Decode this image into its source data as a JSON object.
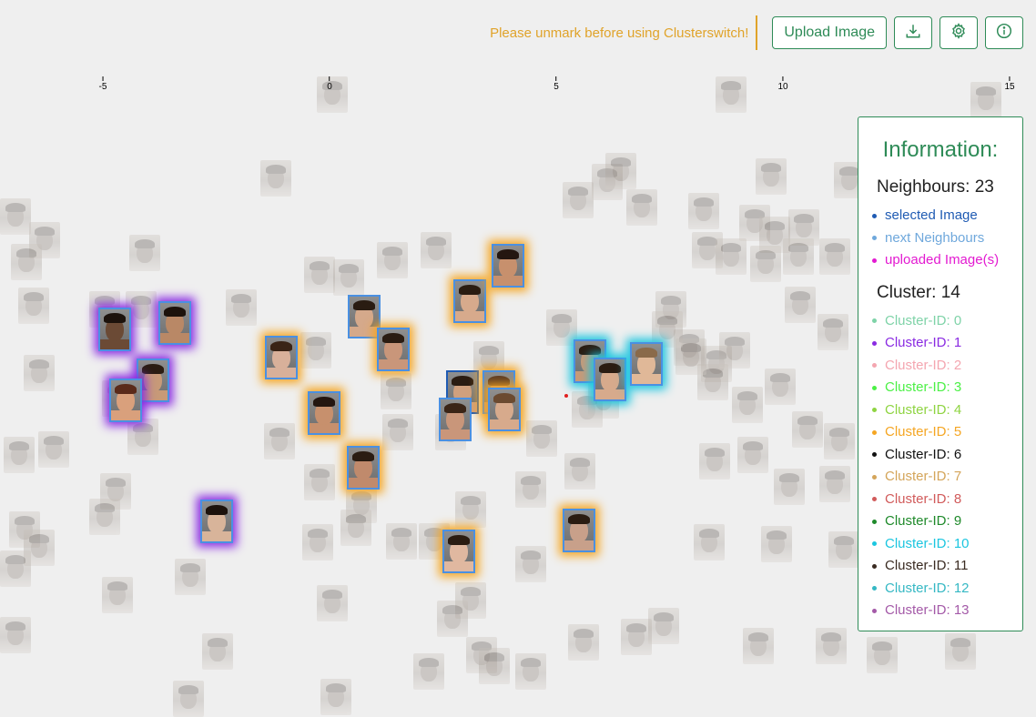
{
  "toolbar": {
    "warning": "Please unmark before using Clusterswitch!",
    "upload_label": "Upload Image",
    "download_icon": "download-icon",
    "settings_icon": "gear-icon",
    "info_icon": "info-icon",
    "warning_color": "#e0a32a",
    "accent": "#2e8b57"
  },
  "axis": {
    "ticks": [
      "-5",
      "0",
      "5",
      "10",
      "15"
    ]
  },
  "info_panel": {
    "title": "Information:",
    "neighbours": "Neighbours: 23",
    "cluster": "Cluster: 14",
    "legend": [
      {
        "label": "selected Image",
        "color": "#1f5bb3"
      },
      {
        "label": "next Neighbours",
        "color": "#6fa8dc"
      },
      {
        "label": "uploaded Image(s)",
        "color": "#e31ad1"
      }
    ],
    "clusters": [
      {
        "label": "Cluster-ID: 0",
        "color": "#7fd3a8"
      },
      {
        "label": "Cluster-ID: 1",
        "color": "#8a2be2"
      },
      {
        "label": "Cluster-ID: 2",
        "color": "#f4a6b0"
      },
      {
        "label": "Cluster-ID: 3",
        "color": "#4cf046"
      },
      {
        "label": "Cluster-ID: 4",
        "color": "#8fd442"
      },
      {
        "label": "Cluster-ID: 5",
        "color": "#f5a623"
      },
      {
        "label": "Cluster-ID: 6",
        "color": "#111111"
      },
      {
        "label": "Cluster-ID: 7",
        "color": "#d4a55a"
      },
      {
        "label": "Cluster-ID: 8",
        "color": "#d15b5b"
      },
      {
        "label": "Cluster-ID: 9",
        "color": "#1f8a2b"
      },
      {
        "label": "Cluster-ID: 10",
        "color": "#1cc6e0"
      },
      {
        "label": "Cluster-ID: 11",
        "color": "#3a2b22"
      },
      {
        "label": "Cluster-ID: 12",
        "color": "#35b8c4"
      },
      {
        "label": "Cluster-ID: 13",
        "color": "#a45aa8"
      }
    ]
  }
}
